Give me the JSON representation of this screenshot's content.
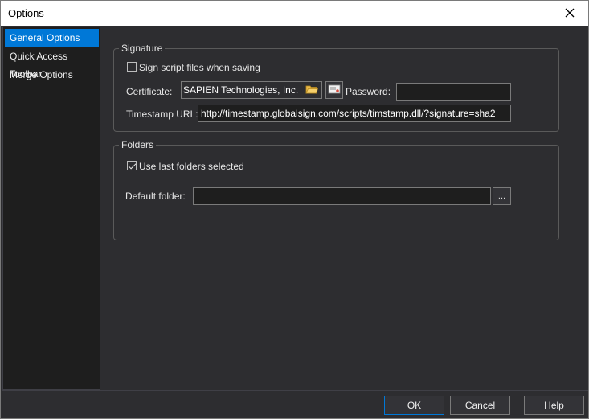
{
  "window": {
    "title": "Options"
  },
  "sidebar": {
    "items": [
      {
        "label": "General Options",
        "selected": true
      },
      {
        "label": "Quick Access Toolbar",
        "selected": false
      },
      {
        "label": "Merge Options",
        "selected": false
      }
    ]
  },
  "signature": {
    "group_title": "Signature",
    "sign_checkbox_label": "Sign script files when saving",
    "sign_checked": false,
    "certificate_label": "Certificate:",
    "certificate_value": "SAPIEN Technologies, Inc.",
    "password_label": "Password:",
    "password_value": "",
    "timestamp_label": "Timestamp URL:",
    "timestamp_value": "http://timestamp.globalsign.com/scripts/timstamp.dll/?signature=sha2"
  },
  "folders": {
    "group_title": "Folders",
    "use_last_label": "Use last folders selected",
    "use_last_checked": true,
    "default_folder_label": "Default folder:",
    "default_folder_value": "",
    "browse_label": "..."
  },
  "footer": {
    "ok_label": "OK",
    "cancel_label": "Cancel",
    "help_label": "Help"
  },
  "colors": {
    "accent": "#0078d7",
    "background": "#2d2d30",
    "field": "#1e1e1e"
  },
  "icons": {
    "close": "close-icon",
    "folder": "folder-icon",
    "certificate": "certificate-icon"
  }
}
